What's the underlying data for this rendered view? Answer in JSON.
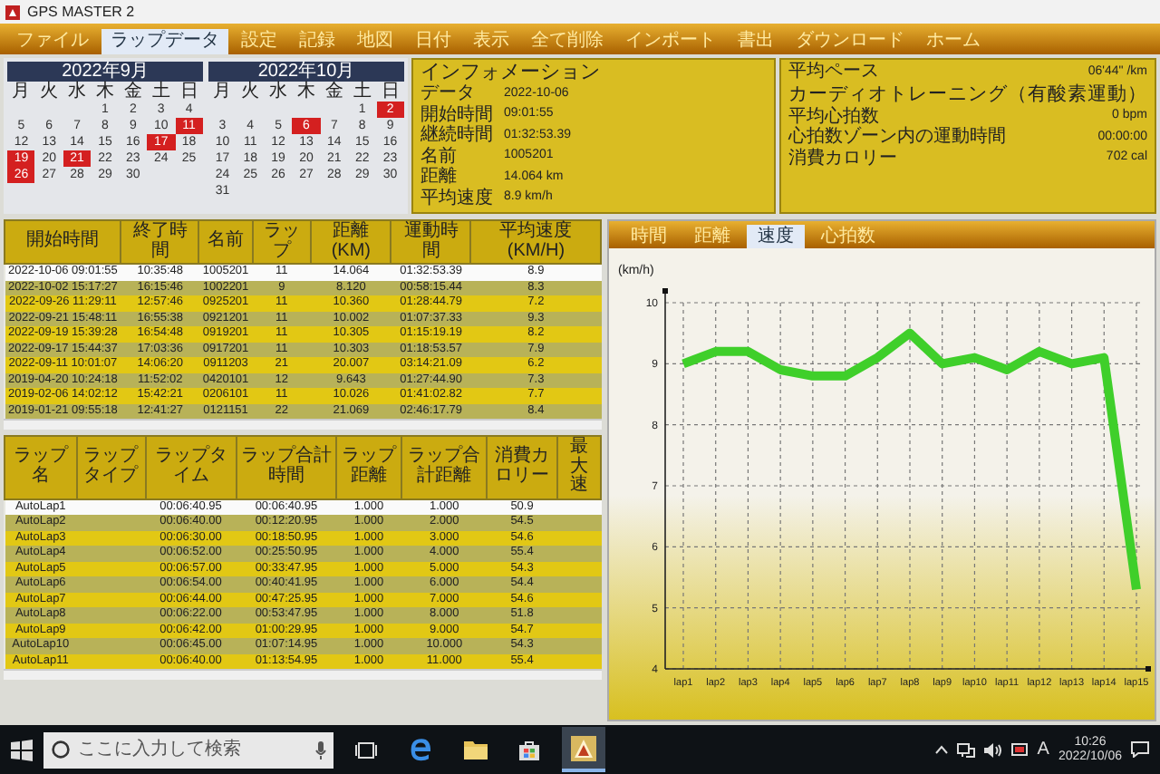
{
  "window": {
    "title": "GPS MASTER 2"
  },
  "menu": [
    {
      "label": "ファイル",
      "selected": false
    },
    {
      "label": "ラップデータ",
      "selected": true
    },
    {
      "label": "設定",
      "selected": false
    },
    {
      "label": "記録",
      "selected": false
    },
    {
      "label": "地図",
      "selected": false
    },
    {
      "label": "日付",
      "selected": false
    },
    {
      "label": "表示",
      "selected": false
    },
    {
      "label": "全て削除",
      "selected": false
    },
    {
      "label": "インポート",
      "selected": false
    },
    {
      "label": "書出",
      "selected": false
    },
    {
      "label": "ダウンロード",
      "selected": false
    },
    {
      "label": "ホーム",
      "selected": false
    }
  ],
  "calendars": [
    {
      "title": "2022年9月",
      "weekdays": [
        "月",
        "火",
        "水",
        "木",
        "金",
        "土",
        "日"
      ],
      "weeks": [
        {
          "days": [
            {
              "kind": "blank"
            },
            {
              "kind": "blank"
            },
            {
              "kind": "blank"
            },
            {
              "day": "1",
              "marked": false
            },
            {
              "day": "2",
              "marked": false
            },
            {
              "day": "3",
              "marked": false
            },
            {
              "day": "4",
              "marked": false
            }
          ]
        },
        {
          "days": [
            {
              "day": "5",
              "marked": false
            },
            {
              "day": "6",
              "marked": false
            },
            {
              "day": "7",
              "marked": false
            },
            {
              "day": "8",
              "marked": false
            },
            {
              "day": "9",
              "marked": false
            },
            {
              "day": "10",
              "marked": false
            },
            {
              "day": "11",
              "marked": true
            }
          ]
        },
        {
          "days": [
            {
              "day": "12",
              "marked": false
            },
            {
              "day": "13",
              "marked": false
            },
            {
              "day": "14",
              "marked": false
            },
            {
              "day": "15",
              "marked": false
            },
            {
              "day": "16",
              "marked": false
            },
            {
              "day": "17",
              "marked": true
            },
            {
              "day": "18",
              "marked": false
            }
          ]
        },
        {
          "days": [
            {
              "day": "19",
              "marked": true
            },
            {
              "day": "20",
              "marked": false
            },
            {
              "day": "21",
              "marked": true
            },
            {
              "day": "22",
              "marked": false
            },
            {
              "day": "23",
              "marked": false
            },
            {
              "day": "24",
              "marked": false
            },
            {
              "day": "25",
              "marked": false
            }
          ]
        },
        {
          "days": [
            {
              "day": "26",
              "marked": true
            },
            {
              "day": "27",
              "marked": false
            },
            {
              "day": "28",
              "marked": false
            },
            {
              "day": "29",
              "marked": false
            },
            {
              "day": "30",
              "marked": false
            }
          ]
        }
      ]
    },
    {
      "title": "2022年10月",
      "weekdays": [
        "月",
        "火",
        "水",
        "木",
        "金",
        "土",
        "日"
      ],
      "weeks": [
        {
          "days": [
            {
              "kind": "blank"
            },
            {
              "kind": "blank"
            },
            {
              "kind": "blank"
            },
            {
              "kind": "blank"
            },
            {
              "kind": "blank"
            },
            {
              "day": "1",
              "marked": false
            },
            {
              "day": "2",
              "marked": true
            }
          ]
        },
        {
          "days": [
            {
              "day": "3",
              "marked": false
            },
            {
              "day": "4",
              "marked": false
            },
            {
              "day": "5",
              "marked": false
            },
            {
              "day": "6",
              "marked": true
            },
            {
              "day": "7",
              "marked": false
            },
            {
              "day": "8",
              "marked": false
            },
            {
              "day": "9",
              "marked": false
            }
          ]
        },
        {
          "days": [
            {
              "day": "10",
              "marked": false
            },
            {
              "day": "11",
              "marked": false
            },
            {
              "day": "12",
              "marked": false
            },
            {
              "day": "13",
              "marked": false
            },
            {
              "day": "14",
              "marked": false
            },
            {
              "day": "15",
              "marked": false
            },
            {
              "day": "16",
              "marked": false
            }
          ]
        },
        {
          "days": [
            {
              "day": "17",
              "marked": false
            },
            {
              "day": "18",
              "marked": false
            },
            {
              "day": "19",
              "marked": false
            },
            {
              "day": "20",
              "marked": false
            },
            {
              "day": "21",
              "marked": false
            },
            {
              "day": "22",
              "marked": false
            },
            {
              "day": "23",
              "marked": false
            }
          ]
        },
        {
          "days": [
            {
              "day": "24",
              "marked": false
            },
            {
              "day": "25",
              "marked": false
            },
            {
              "day": "26",
              "marked": false
            },
            {
              "day": "27",
              "marked": false
            },
            {
              "day": "28",
              "marked": false
            },
            {
              "day": "29",
              "marked": false
            },
            {
              "day": "30",
              "marked": false
            }
          ]
        },
        {
          "days": [
            {
              "day": "31",
              "marked": false
            }
          ]
        }
      ]
    }
  ],
  "info": {
    "title": "インフォメーション",
    "fields": [
      {
        "label": "データ",
        "value": "2022-10-06"
      },
      {
        "label": "開始時間",
        "value": "09:01:55"
      },
      {
        "label": "継続時間",
        "value": "01:32:53.39"
      },
      {
        "label": "名前",
        "value": "1005201"
      },
      {
        "label": "距離",
        "value": "14.064 km"
      },
      {
        "label": "平均速度",
        "value": "8.9 km/h"
      }
    ]
  },
  "summary": {
    "pace": {
      "label": "平均ペース",
      "value": "06'44\" /km"
    },
    "heading": "カーディオトレーニング（有酸素運動）",
    "fields": [
      {
        "label": "平均心拍数",
        "value": "0 bpm"
      },
      {
        "label": "心拍数ゾーン内の運動時間",
        "value": "00:00:00"
      },
      {
        "label": "消費カロリー",
        "value": "702 cal"
      }
    ]
  },
  "sessions": {
    "columns": [
      "開始時間",
      "終了時間",
      "名前",
      "ラップ",
      "距離(KM)",
      "運動時間",
      "平均速度(KM/H)"
    ],
    "rows": [
      {
        "selected": true,
        "cells": [
          "2022-10-06 09:01:55",
          "10:35:48",
          "1005201",
          "11",
          "14.064",
          "01:32:53.39",
          "8.9"
        ]
      },
      {
        "selected": false,
        "cells": [
          "2022-10-02 15:17:27",
          "16:15:46",
          "1002201",
          "9",
          "8.120",
          "00:58:15.44",
          "8.3"
        ]
      },
      {
        "selected": false,
        "cells": [
          "2022-09-26 11:29:11",
          "12:57:46",
          "0925201",
          "11",
          "10.360",
          "01:28:44.79",
          "7.2"
        ]
      },
      {
        "selected": false,
        "cells": [
          "2022-09-21 15:48:11",
          "16:55:38",
          "0921201",
          "11",
          "10.002",
          "01:07:37.33",
          "9.3"
        ]
      },
      {
        "selected": false,
        "cells": [
          "2022-09-19 15:39:28",
          "16:54:48",
          "0919201",
          "11",
          "10.305",
          "01:15:19.19",
          "8.2"
        ]
      },
      {
        "selected": false,
        "cells": [
          "2022-09-17 15:44:37",
          "17:03:36",
          "0917201",
          "11",
          "10.303",
          "01:18:53.57",
          "7.9"
        ]
      },
      {
        "selected": false,
        "cells": [
          "2022-09-11 10:01:07",
          "14:06:20",
          "0911203",
          "21",
          "20.007",
          "03:14:21.09",
          "6.2"
        ]
      },
      {
        "selected": false,
        "cells": [
          "2019-04-20 10:24:18",
          "11:52:02",
          "0420101",
          "12",
          "9.643",
          "01:27:44.90",
          "7.3"
        ]
      },
      {
        "selected": false,
        "cells": [
          "2019-02-06 14:02:12",
          "15:42:21",
          "0206101",
          "11",
          "10.026",
          "01:41:02.82",
          "7.7"
        ]
      },
      {
        "selected": false,
        "cells": [
          "2019-01-21 09:55:18",
          "12:41:27",
          "0121151",
          "22",
          "21.069",
          "02:46:17.79",
          "8.4"
        ]
      }
    ]
  },
  "laps": {
    "columns": [
      "ラップ名",
      "ラップタイプ",
      "ラップタイム",
      "ラップ合計時間",
      "ラップ距離",
      "ラップ合計距離",
      "消費カロリー",
      "最大速"
    ],
    "rows": [
      {
        "selected": true,
        "cells": [
          "AutoLap1",
          null,
          "00:06:40.95",
          "00:06:40.95",
          "1.000",
          "1.000",
          "50.9",
          null
        ]
      },
      {
        "selected": false,
        "cells": [
          "AutoLap2",
          null,
          "00:06:40.00",
          "00:12:20.95",
          "1.000",
          "2.000",
          "54.5",
          null
        ]
      },
      {
        "selected": false,
        "cells": [
          "AutoLap3",
          null,
          "00:06:30.00",
          "00:18:50.95",
          "1.000",
          "3.000",
          "54.6",
          null
        ]
      },
      {
        "selected": false,
        "cells": [
          "AutoLap4",
          null,
          "00:06:52.00",
          "00:25:50.95",
          "1.000",
          "4.000",
          "55.4",
          null
        ]
      },
      {
        "selected": false,
        "cells": [
          "AutoLap5",
          null,
          "00:06:57.00",
          "00:33:47.95",
          "1.000",
          "5.000",
          "54.3",
          null
        ]
      },
      {
        "selected": false,
        "cells": [
          "AutoLap6",
          null,
          "00:06:54.00",
          "00:40:41.95",
          "1.000",
          "6.000",
          "54.4",
          null
        ]
      },
      {
        "selected": false,
        "cells": [
          "AutoLap7",
          null,
          "00:06:44.00",
          "00:47:25.95",
          "1.000",
          "7.000",
          "54.6",
          null
        ]
      },
      {
        "selected": false,
        "cells": [
          "AutoLap8",
          null,
          "00:06:22.00",
          "00:53:47.95",
          "1.000",
          "8.000",
          "51.8",
          null
        ]
      },
      {
        "selected": false,
        "cells": [
          "AutoLap9",
          null,
          "00:06:42.00",
          "01:00:29.95",
          "1.000",
          "9.000",
          "54.7",
          null
        ]
      },
      {
        "selected": false,
        "cells": [
          "AutoLap10",
          null,
          "00:06:45.00",
          "01:07:14.95",
          "1.000",
          "10.000",
          "54.3",
          null
        ]
      },
      {
        "selected": false,
        "cells": [
          "AutoLap11",
          null,
          "00:06:40.00",
          "01:13:54.95",
          "1.000",
          "11.000",
          "55.4",
          null
        ]
      }
    ]
  },
  "chart_panel": {
    "tabs": [
      {
        "label": "時間",
        "selected": false
      },
      {
        "label": "距離",
        "selected": false
      },
      {
        "label": "速度",
        "selected": true
      },
      {
        "label": "心拍数",
        "selected": false
      }
    ],
    "chart_data": {
      "type": "line",
      "ylabel": "(km/h)",
      "categories": [
        "lap1",
        "lap2",
        "lap3",
        "lap4",
        "lap5",
        "lap6",
        "lap7",
        "lap8",
        "lap9",
        "lap10",
        "lap11",
        "lap12",
        "lap13",
        "lap14",
        "lap15"
      ],
      "series": [
        {
          "color": "#3fcf2a",
          "values": [
            9.0,
            9.2,
            9.2,
            8.9,
            8.8,
            8.8,
            9.1,
            9.5,
            9.0,
            9.1,
            8.9,
            9.2,
            9.0,
            9.1,
            5.3
          ]
        }
      ],
      "ylim": [
        4,
        10
      ],
      "yticks": [
        4,
        5,
        6,
        7,
        8,
        9,
        10
      ],
      "grid": true
    }
  },
  "taskbar": {
    "search_placeholder": "ここに入力して検索",
    "apps": [
      {
        "kind": "task-view",
        "selected": false
      },
      {
        "kind": "browser",
        "selected": false
      },
      {
        "kind": "folder",
        "selected": false
      },
      {
        "kind": "store",
        "selected": false
      },
      {
        "kind": "gps-app",
        "selected": true
      }
    ],
    "ime_indicator": "A",
    "time": "10:26",
    "date": "2022/10/06"
  }
}
